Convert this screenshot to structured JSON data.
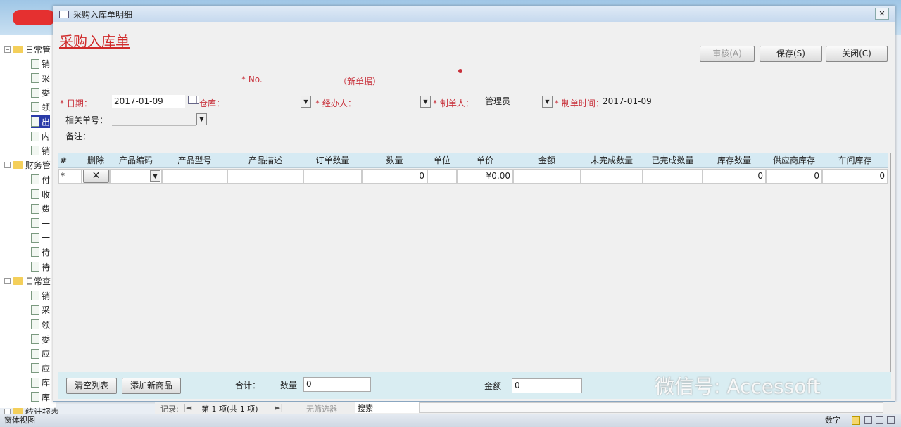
{
  "window": {
    "title": "采购入库单明细",
    "close": "✕"
  },
  "form": {
    "title": "采购入库单",
    "no_label": "* No.",
    "new_doc": "（新单据）",
    "date_label": "* 日期：",
    "date_value": "2017-01-09",
    "warehouse_label": "仓库：",
    "handler_label": "* 经办人：",
    "maker_label": "* 制单人：",
    "maker_value": "管理员",
    "make_time_label": "* 制单时间：",
    "make_time_value": "2017-01-09",
    "related_label": "相关单号：",
    "remark_label": "备注："
  },
  "buttons": {
    "audit": "审核(A)",
    "save": "保存(S)",
    "close": "关闭(C)",
    "clear": "清空列表",
    "add": "添加新商品"
  },
  "grid": {
    "columns": [
      "#",
      "删除",
      "产品编码",
      "产品型号",
      "产品描述",
      "订单数量",
      "数量",
      "单位",
      "单价",
      "金额",
      "未完成数量",
      "已完成数量",
      "库存数量",
      "供应商库存",
      "车间库存"
    ],
    "row": {
      "marker": "*",
      "delete": "✕",
      "qty": "0",
      "price": "¥0.00",
      "stock": "0",
      "supplier_stock": "0",
      "workshop_stock": "0"
    }
  },
  "footer": {
    "total_label": "合计：",
    "qty_label": "数量",
    "qty_value": "0",
    "amount_label": "金额",
    "amount_value": "0"
  },
  "sidebar": {
    "groups": [
      {
        "label": "日常管",
        "items": [
          "销",
          "采",
          "委",
          "领",
          "出",
          "内",
          "销"
        ]
      },
      {
        "label": "财务管",
        "items": [
          "付",
          "收",
          "费",
          "一",
          "一",
          "待",
          "待"
        ]
      },
      {
        "label": "日常查",
        "items": [
          "销",
          "采",
          "领",
          "委",
          "应",
          "应",
          "库",
          "库"
        ]
      },
      {
        "label": "统计报表",
        "items": []
      }
    ]
  },
  "navbar": {
    "record_label": "记录:",
    "position": "第 1 项(共 1 项)",
    "filter": "无筛选器",
    "search": "搜索"
  },
  "status": {
    "view": "窗体视图",
    "numlock": "数字"
  },
  "watermark": "微信号: Accessoft"
}
